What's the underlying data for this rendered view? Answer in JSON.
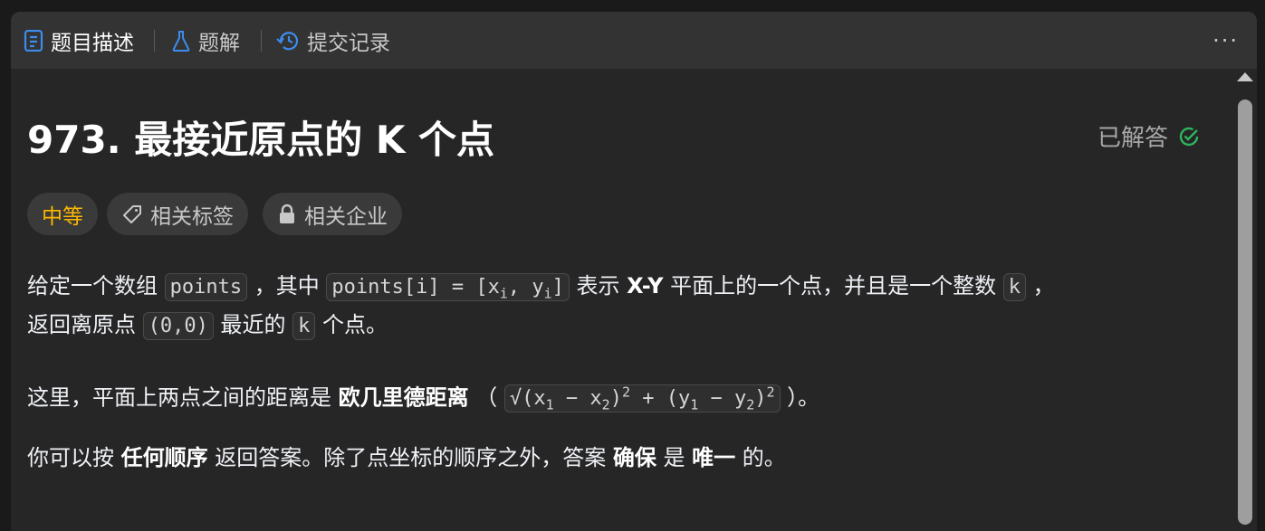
{
  "tabs": [
    {
      "label": "题目描述",
      "icon": "document-icon",
      "active": true
    },
    {
      "label": "题解",
      "icon": "flask-icon",
      "active": false
    },
    {
      "label": "提交记录",
      "icon": "history-icon",
      "active": false
    }
  ],
  "more_label": "···",
  "problem": {
    "title": "973. 最接近原点的 K 个点",
    "status": "已解答",
    "difficulty": "中等",
    "tags_label": "相关标签",
    "companies_label": "相关企业"
  },
  "description": {
    "p1_a": "给定一个数组 ",
    "p1_code1": "points",
    "p1_b": " ，其中 ",
    "p1_code2_prefix": "points[i] = [x",
    "p1_code2_sub1": "i",
    "p1_code2_mid": ", y",
    "p1_code2_sub2": "i",
    "p1_code2_suffix": "]",
    "p1_c": " 表示 ",
    "p1_bold": "X-Y",
    "p1_d": " 平面上的一个点，并且是一个整数 ",
    "p1_code3": "k",
    "p1_e": " ，",
    "p2_a": "返回离原点 ",
    "p2_code1": "(0,0)",
    "p2_b": " 最近的 ",
    "p2_code2": "k",
    "p2_c": " 个点。",
    "p3_a": "这里，平面上两点之间的距离是 ",
    "p3_bold": "欧几里德距离",
    "p3_b": " （ ",
    "p3_formula_1": "√(x",
    "p3_formula_s1": "1",
    "p3_formula_2": " − x",
    "p3_formula_s2": "2",
    "p3_formula_3": ")",
    "p3_formula_p1": "2",
    "p3_formula_4": " + (y",
    "p3_formula_s3": "1",
    "p3_formula_5": " − y",
    "p3_formula_s4": "2",
    "p3_formula_6": ")",
    "p3_formula_p2": "2",
    "p3_c": " ）。",
    "p4_a": "你可以按 ",
    "p4_bold1": "任何顺序",
    "p4_b": " 返回答案。除了点坐标的顺序之外，答案 ",
    "p4_bold2": "确保",
    "p4_c": " 是 ",
    "p4_bold3": "唯一",
    "p4_d": " 的。"
  },
  "colors": {
    "accent_blue": "#3c8ced",
    "solved_green": "#2db55d",
    "difficulty_medium": "#ffb800"
  }
}
